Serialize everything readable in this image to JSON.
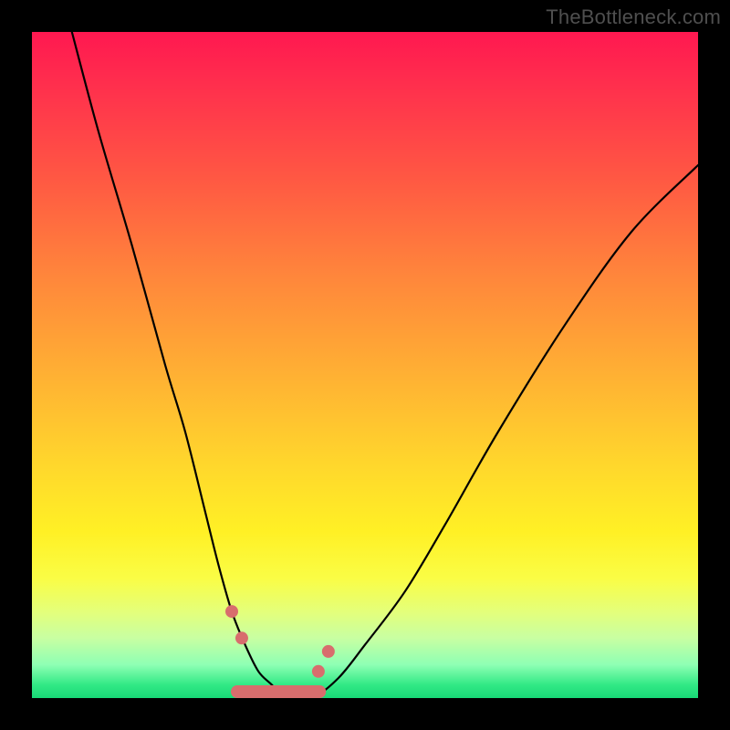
{
  "watermark": "TheBottleneck.com",
  "colors": {
    "background": "#000000",
    "watermark": "#4f4f4f",
    "curve": "#000000",
    "marker": "#d86d6d",
    "gradient_top": "#ff1850",
    "gradient_bottom": "#18d977"
  },
  "chart_data": {
    "type": "line",
    "title": "",
    "xlabel": "",
    "ylabel": "",
    "xlim": [
      0,
      100
    ],
    "ylim": [
      0,
      100
    ],
    "series": [
      {
        "name": "bottleneck-curve",
        "x": [
          6,
          10,
          15,
          20,
          23,
          26,
          28,
          30,
          32,
          34,
          36,
          38,
          42,
          46,
          50,
          56,
          62,
          70,
          80,
          90,
          100
        ],
        "y": [
          100,
          85,
          68,
          50,
          40,
          28,
          20,
          13,
          8,
          4,
          2,
          0,
          0,
          3,
          8,
          16,
          26,
          40,
          56,
          70,
          80
        ]
      }
    ],
    "markers": {
      "name": "highlighted-region",
      "shape": "rounded-band",
      "x_range": [
        30,
        44
      ],
      "y": 0,
      "end_dots": [
        {
          "x": 30,
          "y": 13
        },
        {
          "x": 31.5,
          "y": 9
        },
        {
          "x": 43,
          "y": 4
        },
        {
          "x": 44.5,
          "y": 7
        }
      ]
    }
  }
}
